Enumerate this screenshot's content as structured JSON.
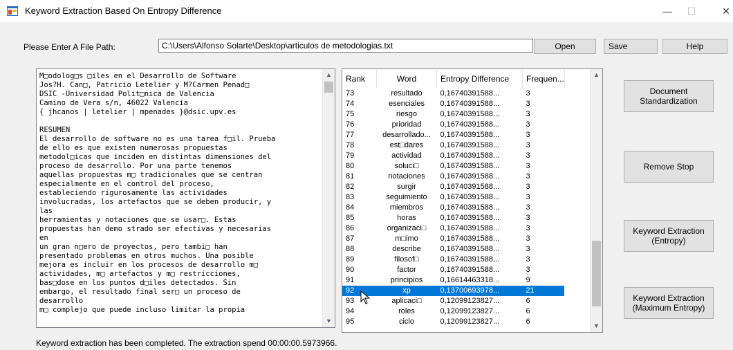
{
  "window": {
    "title": "Keyword Extraction Based On Entropy Difference",
    "minimize": "—",
    "maximize": "☐",
    "close": "✕"
  },
  "file": {
    "label": "Please Enter A File Path:",
    "path": "C:\\Users\\Alfonso Solarte\\Desktop\\articulos de metodologias.txt",
    "open_label": "Open",
    "save_label": "Save",
    "help_label": "Help"
  },
  "document_text": "M□odolog□s □iles en el Desarrollo de Software\nJos?H. Can□, Patricio Letelier y M?Carmen Penad□\nDSIC -Universidad Polit□nica de Valencia\nCamino de Vera s/n, 46022 Valencia\n{ jhcanos | letelier | mpenades }@dsic.upv.es\n\nRESUMEN\nEl desarrollo de software no es una tarea f□il. Prueba\nde ello es que existen numerosas propuestas\nmetodol□icas que inciden en distintas dimensiones del\nproceso de desarrollo. Por una parte tenemos\naquellas propuestas m□ tradicionales que se centran\nespecialmente en el control del proceso,\nestableciendo rigurosamente las actividades\ninvolucradas, los artefactos que se deben producir, y\nlas\nherramientas y notaciones que se usar□. Estas\npropuestas han demo strado ser efectivas y necesarias\nen\nun gran n□ero de proyectos, pero tambi□ han\npresentado problemas en otros muchos. Una posible\nmejora es incluir en los procesos de desarrollo m□\nactividades, m□ artefactos y m□ restricciones,\nbas□dose en los puntos d□iles detectados. Sin\nembargo, el resultado final ser□ un proceso de\ndesarrollo\nm□ complejo que puede incluso limitar la propia",
  "table": {
    "headers": [
      "Rank",
      "Word",
      "Entropy Difference",
      "Frequen..."
    ],
    "rows": [
      [
        "73",
        "resultado",
        "0,16740391588...",
        "3"
      ],
      [
        "74",
        "esenciales",
        "0,16740391588...",
        "3"
      ],
      [
        "75",
        "riesgo",
        "0,16740391588...",
        "3"
      ],
      [
        "76",
        "prioridad",
        "0,16740391588...",
        "3"
      ],
      [
        "77",
        "desarrollado...",
        "0,16740391588...",
        "3"
      ],
      [
        "78",
        "est□dares",
        "0,16740391588...",
        "3"
      ],
      [
        "79",
        "actividad",
        "0,16740391588...",
        "3"
      ],
      [
        "80",
        "soluci□",
        "0,16740391588...",
        "3"
      ],
      [
        "81",
        "notaciones",
        "0,16740391588...",
        "3"
      ],
      [
        "82",
        "surgir",
        "0,16740391588...",
        "3"
      ],
      [
        "83",
        "seguimiento",
        "0,16740391588...",
        "3"
      ],
      [
        "84",
        "miembros",
        "0,16740391588...",
        "3"
      ],
      [
        "85",
        "horas",
        "0,16740391588...",
        "3"
      ],
      [
        "86",
        "organizaci□",
        "0,16740391588...",
        "3"
      ],
      [
        "87",
        "m□imo",
        "0,16740391588...",
        "3"
      ],
      [
        "88",
        "describe",
        "0,16740391588...",
        "3"
      ],
      [
        "89",
        "filosof□",
        "0,16740391588...",
        "3"
      ],
      [
        "90",
        "factor",
        "0,16740391588...",
        "3"
      ],
      [
        "91",
        "principios",
        "0,16614463318...",
        "9"
      ],
      [
        "92",
        "xp",
        "0,13700693978...",
        "21"
      ],
      [
        "93",
        "aplicaci□",
        "0,12099123827...",
        "6"
      ],
      [
        "94",
        "roles",
        "0,12099123827...",
        "6"
      ],
      [
        "95",
        "ciclo",
        "0,12099123827...",
        "6"
      ]
    ],
    "selected_rank": "92"
  },
  "actions": {
    "standardization": "Document Standardization",
    "remove_stop": "Remove Stop",
    "extraction_entropy": "Keyword Extraction (Entropy)",
    "extraction_max": "Keyword Extraction (Maximum Entropy)"
  },
  "status": "Keyword extraction has been completed. The extraction spend 00:00:00.5973966.",
  "colors": {
    "selection": "#0078d7",
    "button_face": "#e1e1e1",
    "window_bg": "#f0f0f0"
  }
}
